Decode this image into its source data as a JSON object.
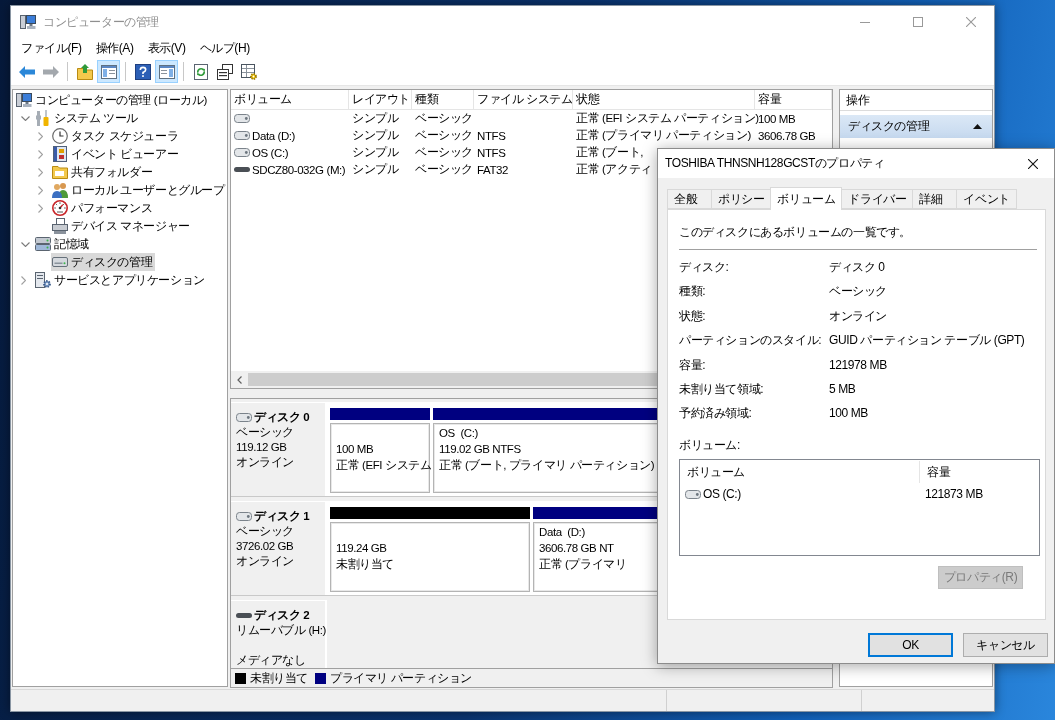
{
  "window": {
    "title": "コンピューターの管理"
  },
  "menu": [
    "ファイル(F)",
    "操作(A)",
    "表示(V)",
    "ヘルプ(H)"
  ],
  "toolbar": {
    "groups": [
      [
        {
          "pressed": false,
          "disabled": false
        },
        {
          "pressed": false,
          "disabled": true
        }
      ],
      [
        {
          "pressed": false,
          "disabled": false
        },
        {
          "pressed": true,
          "disabled": false
        }
      ],
      [
        {
          "pressed": false,
          "disabled": false
        },
        {
          "pressed": true,
          "disabled": false
        }
      ],
      [
        {
          "pressed": false,
          "disabled": false
        },
        {
          "pressed": false,
          "disabled": false
        },
        {
          "pressed": false,
          "disabled": false
        }
      ]
    ]
  },
  "tree": [
    {
      "label": "コンピューターの管理 (ローカル)",
      "selected": false,
      "children": [
        {
          "label": "システム ツール",
          "expanded": true,
          "selected": false,
          "children": [
            {
              "label": "タスク スケジューラ",
              "expanded": false,
              "selected": false
            },
            {
              "label": "イベント ビューアー",
              "expanded": false,
              "selected": false
            },
            {
              "label": "共有フォルダー",
              "expanded": false,
              "selected": false
            },
            {
              "label": "ローカル ユーザーとグループ",
              "expanded": false,
              "selected": false
            },
            {
              "label": "パフォーマンス",
              "expanded": false,
              "selected": false
            },
            {
              "label": "デバイス マネージャー",
              "selected": false
            }
          ]
        },
        {
          "label": "記憶域",
          "expanded": true,
          "selected": false,
          "children": [
            {
              "label": "ディスクの管理",
              "selected": true
            }
          ]
        },
        {
          "label": "サービスとアプリケーション",
          "expanded": false,
          "selected": false
        }
      ]
    }
  ],
  "volume_list": {
    "columns": [
      "ボリューム",
      "レイアウト",
      "種類",
      "ファイル システム",
      "状態",
      "容量"
    ],
    "rows": [
      {
        "kind": "fixed",
        "layout": "シンプル",
        "type": "ベーシック",
        "status": "正常 (EFI システム パーティション)",
        "capacity": "100 MB"
      },
      {
        "kind": "fixed",
        "volume": "Data (D:)",
        "layout": "シンプル",
        "type": "ベーシック",
        "file_system": "NTFS",
        "status": "正常 (プライマリ パーティション)",
        "capacity": "3606.78 GB"
      },
      {
        "kind": "fixed",
        "volume": "OS (C:)",
        "layout": "シンプル",
        "type": "ベーシック",
        "file_system": "NTFS",
        "status": "正常 (ブート,"
      },
      {
        "kind": "removable",
        "volume": "SDCZ80-032G (M:)",
        "layout": "シンプル",
        "type": "ベーシック",
        "file_system": "FAT32",
        "status": "正常 (アクティ"
      }
    ]
  },
  "disks": [
    {
      "kind": "fixed",
      "name": "ディスク 0",
      "type": "ベーシック",
      "size": "119.12 GB",
      "status": "オンライン",
      "partitions": [
        {
          "color": "#000080",
          "size": "100 MB",
          "status": "正常 (EFI システム"
        },
        {
          "color": "#000080",
          "label": "OS  (C:)",
          "size": "119.02 GB NTFS",
          "status": "正常 (ブート, プライマリ パーティション)"
        }
      ]
    },
    {
      "kind": "fixed",
      "name": "ディスク 1",
      "type": "ベーシック",
      "size": "3726.02 GB",
      "status": "オンライン",
      "partitions": [
        {
          "color": "#000000",
          "size": "119.24 GB",
          "status": "未割り当て"
        },
        {
          "color": "#000080",
          "label": "Data  (D:)",
          "size": "3606.78 GB NT",
          "status": "正常 (プライマリ"
        }
      ]
    },
    {
      "kind": "removable",
      "name": "ディスク 2",
      "type": "リムーバブル (H:)",
      "status": "メディアなし"
    }
  ],
  "legend": [
    {
      "label": "未割り当て",
      "color": "#000000"
    },
    {
      "label": "プライマリ パーティション",
      "color": "#000080"
    }
  ],
  "actions": {
    "title": "操作",
    "items": [
      {
        "label": "ディスクの管理",
        "expanded": true
      }
    ]
  },
  "dialog": {
    "title": "TOSHIBA THNSNH128GCSTのプロパティ",
    "tabs": [
      {
        "label": "全般",
        "selected": false
      },
      {
        "label": "ポリシー",
        "selected": false
      },
      {
        "label": "ボリューム",
        "selected": true
      },
      {
        "label": "ドライバー",
        "selected": false
      },
      {
        "label": "詳細",
        "selected": false
      },
      {
        "label": "イベント",
        "selected": false
      }
    ],
    "intro": "このディスクにあるボリュームの一覧です。",
    "properties": [
      {
        "label": "ディスク:",
        "value": "ディスク 0"
      },
      {
        "label": "種類:",
        "value": "ベーシック"
      },
      {
        "label": "状態:",
        "value": "オンライン"
      },
      {
        "label": "パーティションのスタイル:",
        "value": "GUID パーティション テーブル (GPT)"
      },
      {
        "label": "容量:",
        "value": "121978 MB"
      },
      {
        "label": "未割り当て領域:",
        "value": "5 MB"
      },
      {
        "label": "予約済み領域:",
        "value": "100 MB"
      }
    ],
    "volumes_label": "ボリューム:",
    "volume_table": {
      "columns": [
        "ボリューム",
        "容量"
      ],
      "rows": [
        {
          "kind": "fixed",
          "volume": "OS (C:)",
          "capacity": "121873 MB"
        }
      ]
    },
    "properties_button": {
      "label": "プロパティ(R)",
      "disabled": true
    },
    "buttons": [
      {
        "label": "OK",
        "default": true
      },
      {
        "label": "キャンセル",
        "default": false
      }
    ]
  }
}
